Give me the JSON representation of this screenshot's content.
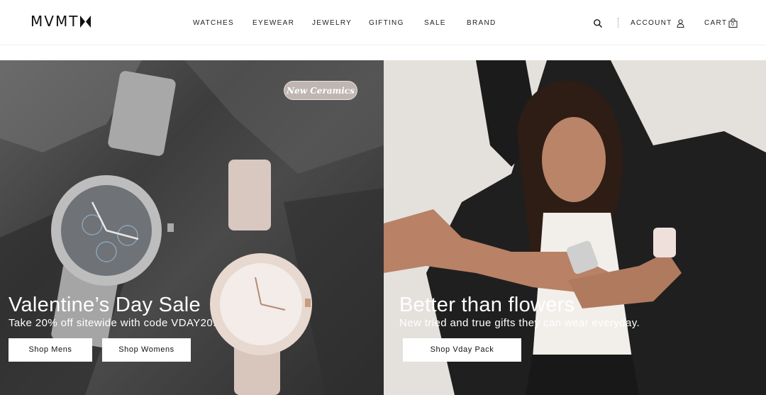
{
  "header": {
    "logo": "MVMT",
    "nav": [
      "WATCHES",
      "EYEWEAR",
      "JEWELRY",
      "GIFTING",
      "SALE",
      "BRAND"
    ],
    "account_label": "ACCOUNT",
    "cart_label": "CART",
    "cart_count": "0"
  },
  "hero_left": {
    "badge": "New Ceramics",
    "title": "Valentine’s Day Sale",
    "subtitle": "Take 20% off sitewide with code VDAY20.",
    "buttons": [
      "Shop Mens",
      "Shop Womens"
    ]
  },
  "hero_right": {
    "title": "Better than flowers",
    "subtitle": "New tried and true gifts they can wear everyday.",
    "button": "Shop Vday Pack"
  },
  "colors": {
    "text": "#111111",
    "button_bg": "#ffffff"
  }
}
